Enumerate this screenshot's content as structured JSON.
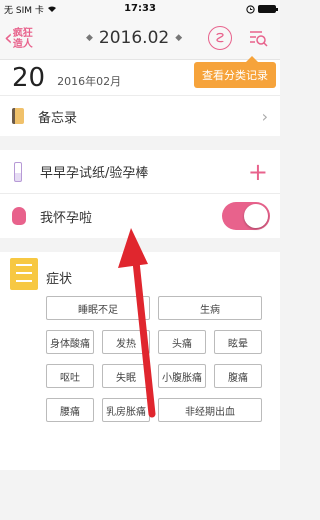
{
  "status_bar": {
    "carrier": "无 SIM 卡",
    "time": "17:33"
  },
  "navbar": {
    "logo_line1": "疯狂",
    "logo_line2": "造人",
    "month": "2016.02",
    "prev_arrow": "◆",
    "next_arrow": "◆"
  },
  "tooltip": "查看分类记录",
  "date": {
    "day": "20",
    "month": "2016年02月"
  },
  "memo": {
    "label": "备忘录"
  },
  "ovulation": {
    "label": "早早孕试纸/验孕棒"
  },
  "pregnant": {
    "label": "我怀孕啦",
    "enabled": true
  },
  "symptoms": {
    "title": "症状",
    "tags": [
      "睡眠不足",
      "生病",
      "身体酸痛",
      "发热",
      "头痛",
      "眩晕",
      "呕吐",
      "失眠",
      "小腹胀痛",
      "腹痛",
      "腰痛",
      "乳房胀痛",
      "非经期出血"
    ]
  },
  "colors": {
    "accent": "#e8628c",
    "tooltip": "#f6a33b",
    "arrow": "#e0262e"
  }
}
